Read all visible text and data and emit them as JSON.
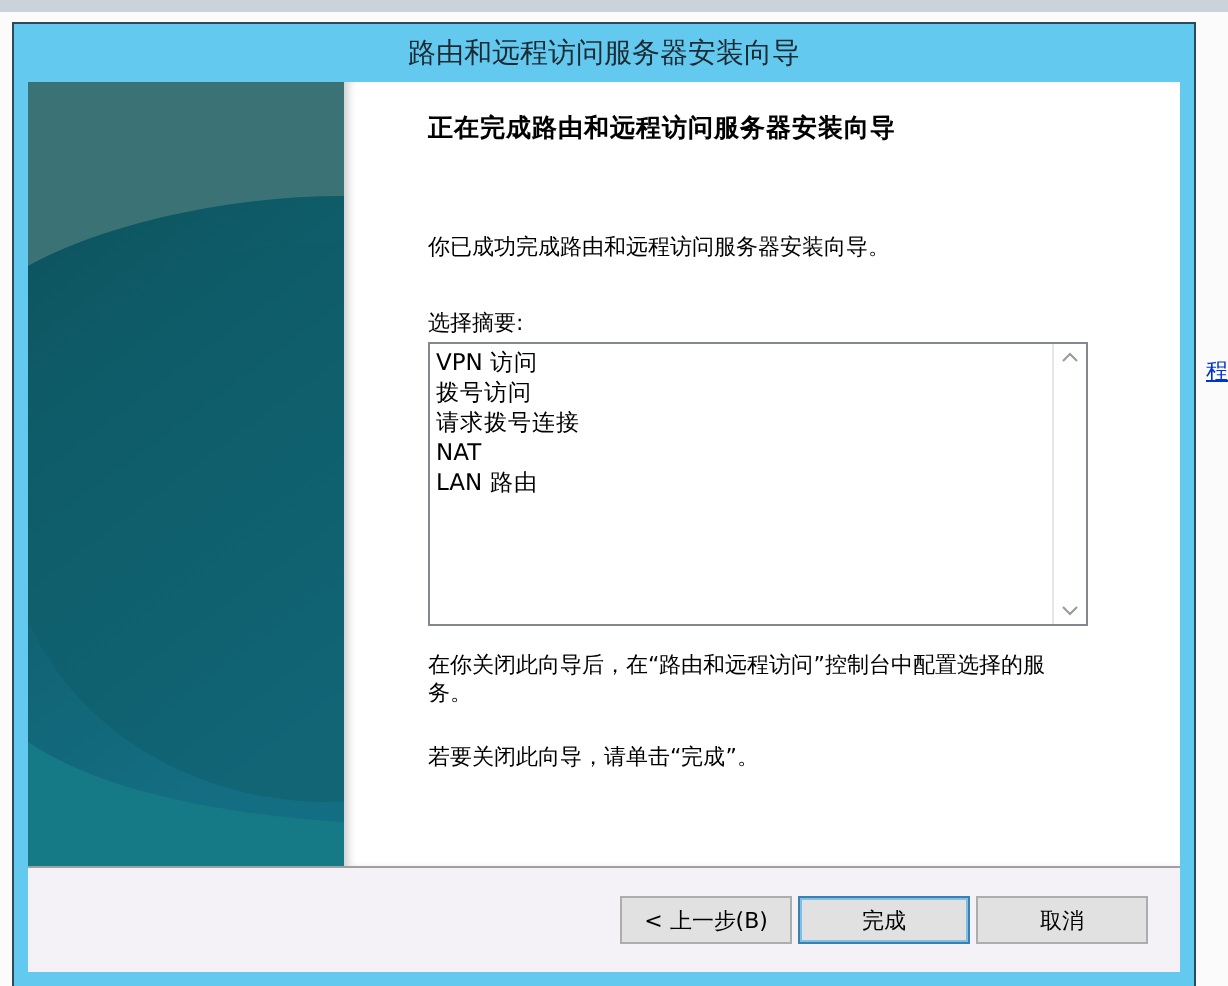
{
  "window": {
    "title": "路由和远程访问服务器安装向导"
  },
  "background": {
    "link": "程"
  },
  "page": {
    "heading": "正在完成路由和远程访问服务器安装向导",
    "intro": "你已成功完成路由和远程访问服务器安装向导。",
    "summary_label": "选择摘要:",
    "summary_items": [
      "VPN 访问",
      "拨号访问",
      "请求拨号连接",
      "NAT",
      "LAN 路由"
    ],
    "note": "在你关闭此向导后，在“路由和远程访问”控制台中配置选择的服务。",
    "close_hint": "若要关闭此向导，请单击“完成”。"
  },
  "buttons": [
    {
      "label": "< 上一步(B)",
      "default": false
    },
    {
      "label": "完成",
      "default": true
    },
    {
      "label": "取消",
      "default": false
    }
  ]
}
